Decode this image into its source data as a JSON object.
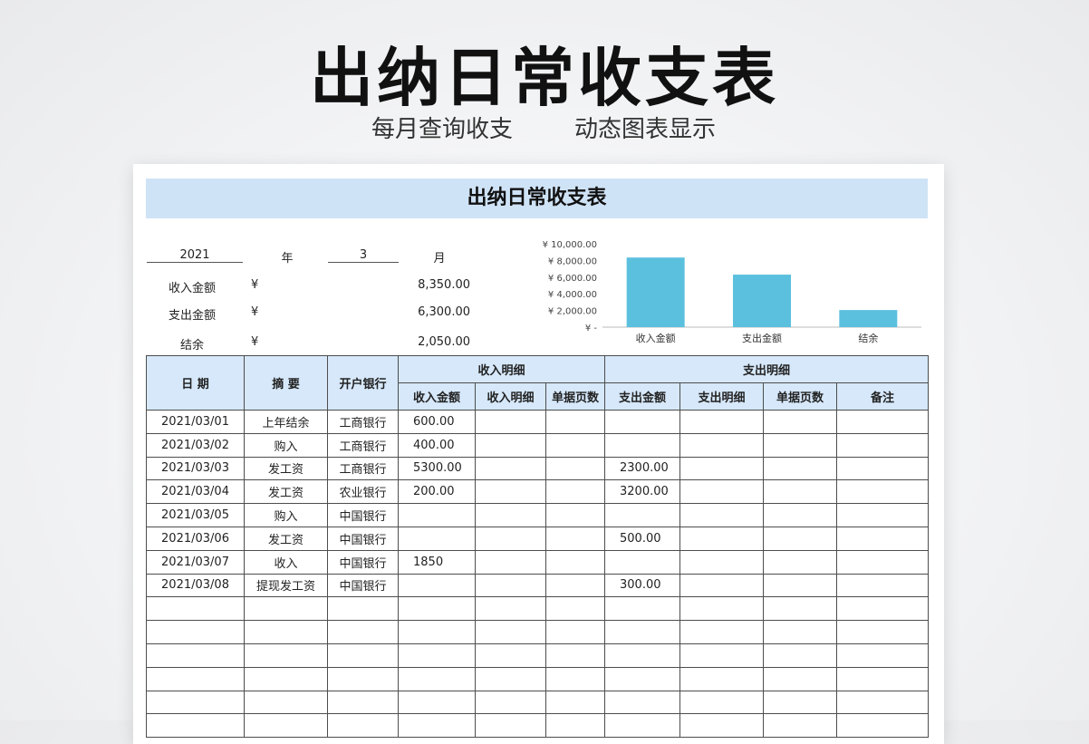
{
  "hero": {
    "title": "出纳日常收支表",
    "subtitle_left": "每月查询收支",
    "subtitle_right": "动态图表显示"
  },
  "sheet": {
    "banner_title": "出纳日常收支表",
    "selector": {
      "year": "2021",
      "year_unit": "年",
      "month": "3",
      "month_unit": "月"
    },
    "summary": [
      {
        "label": "收入金额",
        "currency": "¥",
        "value": "8,350.00"
      },
      {
        "label": "支出金额",
        "currency": "¥",
        "value": "6,300.00"
      },
      {
        "label": "结余",
        "currency": "¥",
        "value": "2,050.00"
      }
    ]
  },
  "chart_data": {
    "type": "bar",
    "categories": [
      "收入金额",
      "支出金额",
      "结余"
    ],
    "values": [
      8350,
      6300,
      2050
    ],
    "ylim": [
      0,
      10000
    ],
    "yticks": [
      "¥ 10,000.00",
      "¥ 8,000.00",
      "¥ 6,000.00",
      "¥ 4,000.00",
      "¥ 2,000.00",
      "¥ -"
    ],
    "bar_color": "#5bc0de",
    "grid": false,
    "legend": "none"
  },
  "table": {
    "headers": {
      "date": "日 期",
      "summary": "摘 要",
      "bank": "开户银行",
      "income_group": "收入明细",
      "expense_group": "支出明细",
      "sub": [
        "收入金额",
        "收入明细",
        "单据页数",
        "支出金额",
        "支出明细",
        "单据页数",
        "备注"
      ]
    },
    "rows": [
      [
        "2021/03/01",
        "上年结余",
        "工商银行",
        "600.00",
        "",
        "",
        "",
        "",
        "",
        ""
      ],
      [
        "2021/03/02",
        "购入",
        "工商银行",
        "400.00",
        "",
        "",
        "",
        "",
        "",
        ""
      ],
      [
        "2021/03/03",
        "发工资",
        "工商银行",
        "5300.00",
        "",
        "",
        "2300.00",
        "",
        "",
        ""
      ],
      [
        "2021/03/04",
        "发工资",
        "农业银行",
        "200.00",
        "",
        "",
        "3200.00",
        "",
        "",
        ""
      ],
      [
        "2021/03/05",
        "购入",
        "中国银行",
        "",
        "",
        "",
        "",
        "",
        "",
        ""
      ],
      [
        "2021/03/06",
        "发工资",
        "中国银行",
        "",
        "",
        "",
        "500.00",
        "",
        "",
        ""
      ],
      [
        "2021/03/07",
        "收入",
        "中国银行",
        "1850",
        "",
        "",
        "",
        "",
        "",
        ""
      ],
      [
        "2021/03/08",
        "提现发工资",
        "中国银行",
        "",
        "",
        "",
        "300.00",
        "",
        "",
        ""
      ],
      [
        "",
        "",
        "",
        "",
        "",
        "",
        "",
        "",
        "",
        ""
      ],
      [
        "",
        "",
        "",
        "",
        "",
        "",
        "",
        "",
        "",
        ""
      ],
      [
        "",
        "",
        "",
        "",
        "",
        "",
        "",
        "",
        "",
        ""
      ],
      [
        "",
        "",
        "",
        "",
        "",
        "",
        "",
        "",
        "",
        ""
      ],
      [
        "",
        "",
        "",
        "",
        "",
        "",
        "",
        "",
        "",
        ""
      ],
      [
        "",
        "",
        "",
        "",
        "",
        "",
        "",
        "",
        "",
        ""
      ]
    ]
  }
}
